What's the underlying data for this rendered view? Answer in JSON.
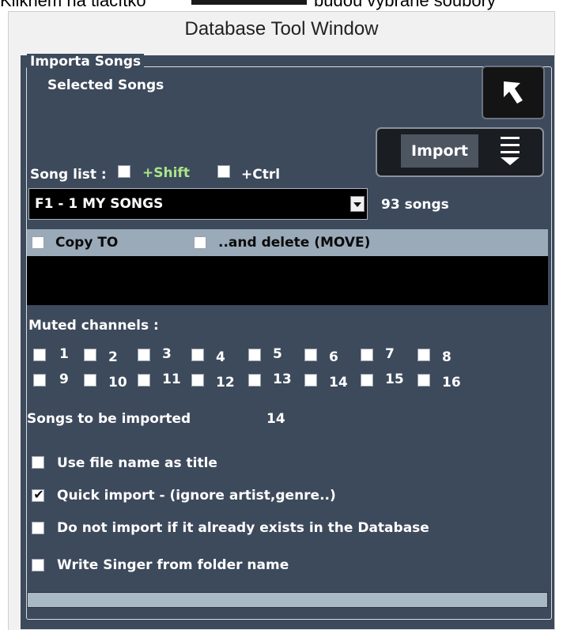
{
  "caption": {
    "left_text": "Kliknem na tlačítko",
    "right_text": "budou vybrané soubory"
  },
  "window": {
    "title": "Database Tool Window"
  },
  "group": {
    "title": "Importa Songs",
    "selected_songs_label": "Selected Songs"
  },
  "import_button": {
    "label": "Import",
    "icon": "menu-icon"
  },
  "back_button": {
    "icon": "back-arrow-icon"
  },
  "song_list": {
    "label": "Song list :",
    "shift_label": "+Shift",
    "ctrl_label": "+Ctrl",
    "selected": "F1 - 1 MY SONGS",
    "count": "93 songs"
  },
  "copy": {
    "copy_to_label": "Copy TO",
    "move_label": "..and delete (MOVE)"
  },
  "muted": {
    "label": "Muted channels :",
    "channels": [
      "1",
      "2",
      "3",
      "4",
      "5",
      "6",
      "7",
      "8",
      "9",
      "10",
      "11",
      "12",
      "13",
      "14",
      "15",
      "16"
    ]
  },
  "songs_to_import": {
    "label": "Songs to be imported",
    "value": "14"
  },
  "options": [
    {
      "label": "Use file name as title",
      "checked": false
    },
    {
      "label": "Quick import - (ignore artist,genre..)",
      "checked": true
    },
    {
      "label": "Do not import if it already exists in the Database",
      "checked": false
    },
    {
      "label": "Write Singer from folder name",
      "checked": false
    }
  ],
  "colors": {
    "panel": "#3d4a5c",
    "copy_bar": "#9aaab9",
    "shift_ctrl_text": "#a9e58a"
  }
}
